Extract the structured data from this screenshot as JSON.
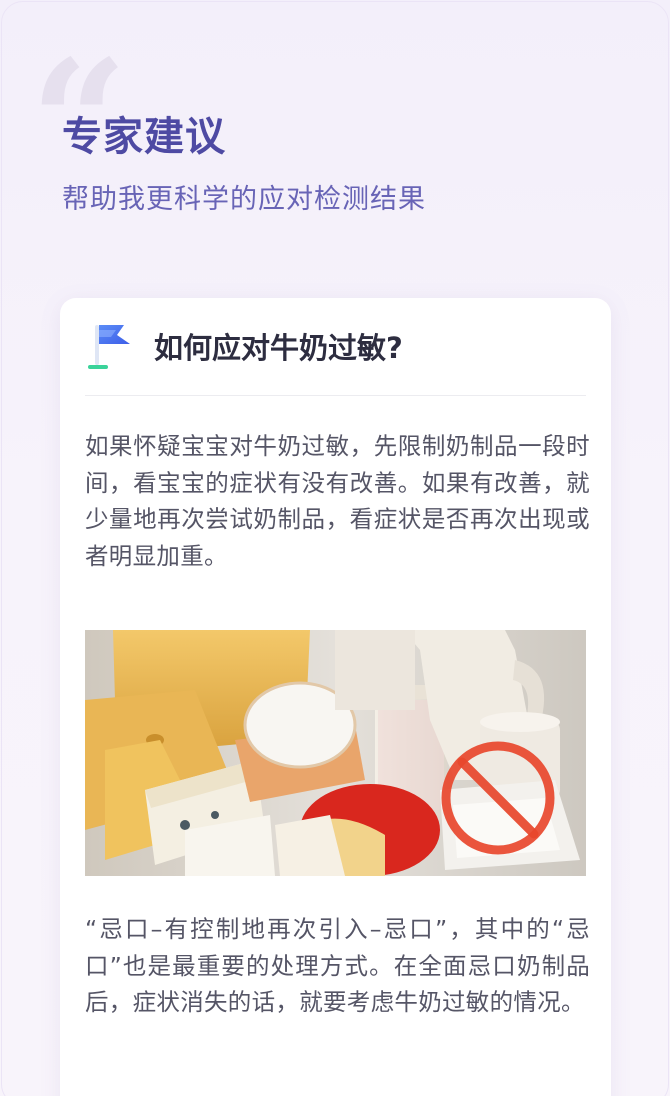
{
  "hero": {
    "title": "专家建议",
    "subtitle": "帮助我更科学的应对检测结果"
  },
  "card": {
    "title": "如何应对牛奶过敏?",
    "paragraph_1": "如果怀疑宝宝对牛奶过敏，先限制奶制品一段时间，看宝宝的症状有没有改善。如果有改善，就少量地再次尝试奶制品，看症状是否再次出现或者明显加重。",
    "paragraph_2": "“忌口–有控制地再次引入–忌口”，其中的“忌口”也是最重要的处理方式。在全面忌口奶制品后，症状消失的话，就要考虑牛奶过敏的情况。"
  },
  "icons": {
    "flag": "flag-icon",
    "prohibition": "no-sign-icon",
    "quote": "quote-mark-icon"
  },
  "colors": {
    "accent": "#4e4aa3",
    "subtitle": "#6864b6",
    "body_text": "#555566",
    "prohibition_red": "#e8472c"
  }
}
